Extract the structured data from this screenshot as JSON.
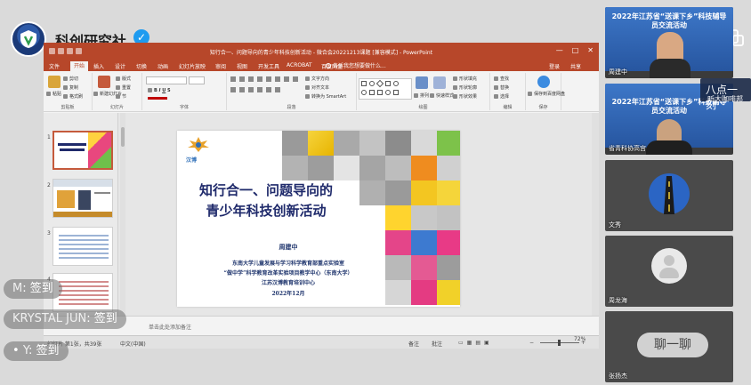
{
  "channel": {
    "name": "科创研究社",
    "verified": true
  },
  "ppt": {
    "title": "知行合一、问题导向的青少年科技创新活动 - 微合会20221213课题 [兼容模式] - PowerPoint",
    "window_controls": [
      "—",
      "□",
      "✕"
    ],
    "tabs": [
      "文件",
      "开始",
      "插入",
      "设计",
      "切换",
      "动画",
      "幻灯片放映",
      "审阅",
      "视图",
      "开发工具",
      "ACROBAT",
      "百度网盘"
    ],
    "active_tab": "开始",
    "tell_me": "告诉我您想要做什么...",
    "account": [
      "登录",
      "共享"
    ],
    "ribbon": {
      "clipboard": {
        "label": "剪贴板",
        "paste": "粘贴",
        "items": [
          "剪切",
          "复制",
          "格式刷"
        ]
      },
      "slides": {
        "label": "幻灯片",
        "new_slide": "新建幻灯片",
        "items": [
          "版式",
          "重置",
          "节"
        ]
      },
      "font": {
        "label": "字体"
      },
      "paragraph": {
        "label": "段落",
        "items": [
          "文字方向",
          "对齐文本",
          "转换为 SmartArt"
        ]
      },
      "drawing": {
        "label": "绘图",
        "arrange": "排列",
        "quick_styles": "快速样式",
        "items": [
          "形状填充",
          "形状轮廓",
          "形状效果"
        ]
      },
      "editing": {
        "label": "编辑",
        "items": [
          "查找",
          "替换",
          "选择"
        ]
      },
      "save": {
        "label": "保存",
        "item": "保存到百度网盘"
      }
    },
    "thumb_numbers": [
      "1",
      "2",
      "3",
      "4"
    ],
    "slide": {
      "logo_text": "汉博",
      "title_line1": "知行合一、问题导向的",
      "title_line2": "青少年科技创新活动",
      "presenter": "周建中",
      "affiliation_line1": "东南大学儿童发展与学习科学教育部重点实验室",
      "affiliation_line2": "“做中学”科学教育改革实验项目教学中心（东南大学）",
      "affiliation_line3": "江苏汉博教育培训中心",
      "date": "2022年12月"
    },
    "notes_placeholder": "单击此处添加备注",
    "status": {
      "slide_info": "幻灯片 第1张，共39张",
      "language": "中文(中国)",
      "notes_btn": "备注",
      "comments_btn": "批注",
      "zoom": "72%"
    }
  },
  "participants": [
    {
      "name": "周建中",
      "banner": "2022年江苏省“送课下乡”科技辅导员交流活动"
    },
    {
      "name": "省青科协高宫",
      "banner": "2022年江苏省“送课下乡”科技辅导员交流活动"
    },
    {
      "name": "文秀"
    },
    {
      "name": "周龙海"
    },
    {
      "name": "张扬杰"
    }
  ],
  "floating_notice": {
    "line1": "八点一刻",
    "line2": "昕大咖啡邦"
  },
  "chat": [
    {
      "user": "M",
      "message": "签到"
    },
    {
      "user": "KRYSTAL JUN",
      "message": "签到"
    },
    {
      "user": "Y",
      "message": "签到"
    }
  ],
  "chat_button": "聊一聊",
  "colors": {
    "ppt_accent": "#b7472a",
    "verified": "#1d9bf0",
    "slide_title": "#1f2a6b"
  }
}
